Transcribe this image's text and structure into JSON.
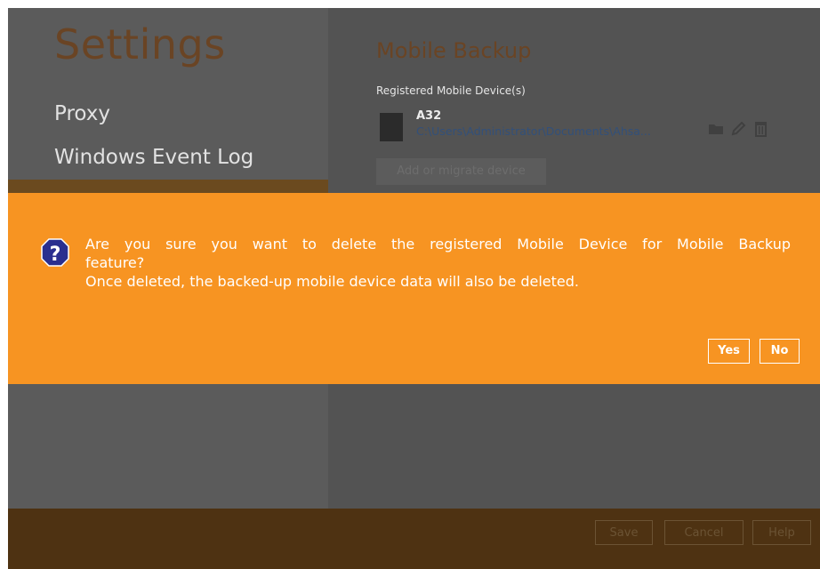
{
  "sidebar": {
    "title": "Settings",
    "items": [
      {
        "label": "Proxy"
      },
      {
        "label": "Windows Event Log"
      }
    ]
  },
  "main": {
    "title": "Mobile Backup",
    "registered_label": "Registered Mobile Device(s)",
    "device": {
      "name": "A32",
      "path": "C:\\Users\\Administrator\\Documents\\Ahsa..."
    },
    "add_device_label": "Add or migrate device"
  },
  "footer": {
    "save_label": "Save",
    "cancel_label": "Cancel",
    "help_label": "Help"
  },
  "dialog": {
    "line1": "Are you sure you want to delete the registered Mobile Device for Mobile Backup",
    "line2": "feature?",
    "line3": "Once deleted, the backed-up mobile device data will also be deleted.",
    "yes_label": "Yes",
    "no_label": "No",
    "icon": "question-icon"
  },
  "colors": {
    "accent": "#f79422",
    "question_icon": "#2a2f8f",
    "sidebar_overlay": "#5b5b5b",
    "footer_overlay": "#4e3212"
  }
}
